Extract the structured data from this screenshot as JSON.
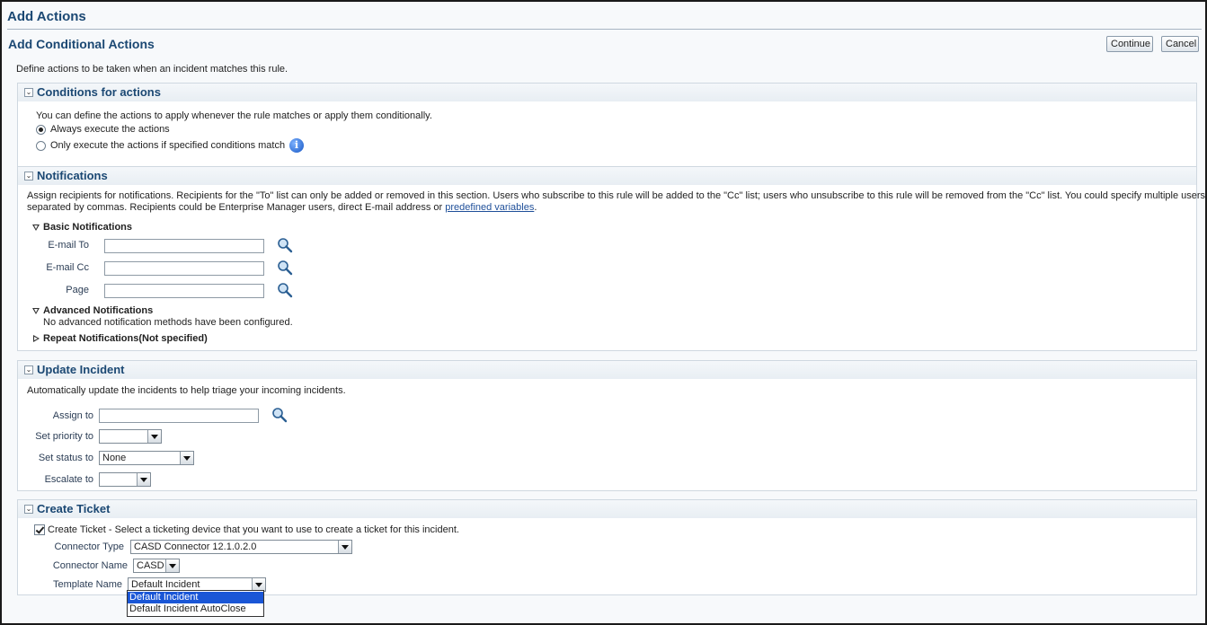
{
  "window": {
    "title": "Add Actions"
  },
  "page": {
    "title": "Add Conditional Actions",
    "description": "Define actions to be taken when an incident matches this rule.",
    "continue_label": "Continue",
    "cancel_label": "Cancel"
  },
  "conditions": {
    "title": "Conditions for actions",
    "intro": "You can define the actions to apply whenever the rule matches or apply them conditionally.",
    "option_always": "Always execute the actions",
    "option_conditional": "Only execute the actions if specified conditions match",
    "selected": "always"
  },
  "notifications": {
    "title": "Notifications",
    "desc_line1": "Assign recipients for notifications. Recipients for the \"To\" list can only be added or removed in this section. Users who subscribe to this rule will be added to the \"Cc\" list; users who unsubscribe to this rule will be removed from the \"Cc\" list. You could specify multiple users",
    "desc_line2_prefix": "separated by commas. Recipients could be Enterprise Manager users, direct E-mail address or ",
    "desc_link": "predefined variables",
    "desc_line2_suffix": ".",
    "basic_title": "Basic Notifications",
    "email_to_label": "E-mail To",
    "email_to_value": "",
    "email_cc_label": "E-mail Cc",
    "email_cc_value": "",
    "page_label": "Page",
    "page_value": "",
    "advanced_title": "Advanced Notifications",
    "advanced_note": "No advanced notification methods have been configured.",
    "repeat_title": "Repeat Notifications(Not specified)"
  },
  "update_incident": {
    "title": "Update Incident",
    "desc": "Automatically update the incidents to help triage your incoming incidents.",
    "assign_label": "Assign to",
    "assign_value": "",
    "priority_label": "Set priority to",
    "priority_value": "",
    "status_label": "Set status to",
    "status_value": "None",
    "escalate_label": "Escalate to",
    "escalate_value": ""
  },
  "create_ticket": {
    "title": "Create Ticket",
    "checkbox_label": "Create Ticket - Select a ticketing device that you want to use to create a ticket for this incident.",
    "checked": true,
    "connector_type_label": "Connector Type",
    "connector_type_value": "CASD Connector 12.1.0.2.0",
    "connector_name_label": "Connector Name",
    "connector_name_value": "CASD",
    "template_label": "Template Name",
    "template_value": "Default Incident",
    "template_options": [
      "Default Incident",
      "Default Incident AutoClose"
    ]
  },
  "icons": {
    "search": "search-icon",
    "info": "info-icon",
    "disclose": "collapse-icon"
  },
  "colors": {
    "heading": "#1b4873",
    "link": "#1f4f99",
    "selected_option": "#1a56d6"
  }
}
